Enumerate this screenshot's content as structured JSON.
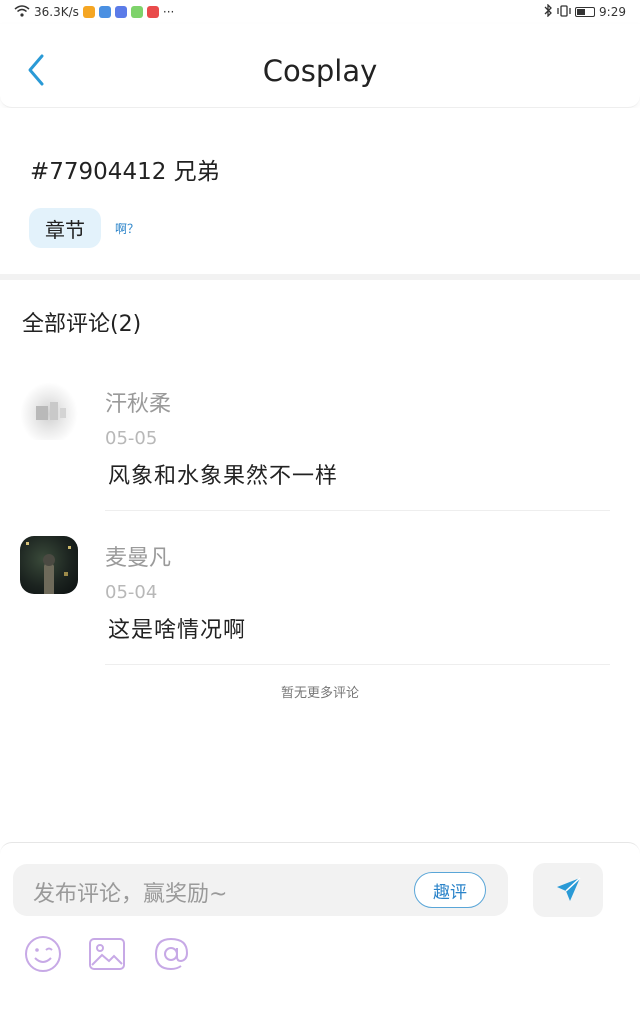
{
  "status_bar": {
    "network_speed": "36.3K/s",
    "more": "···",
    "time": "9:29"
  },
  "header": {
    "title": "Cosplay"
  },
  "post": {
    "title": "#77904412 兄弟",
    "chapter_label": "章节",
    "chapter_sub": "啊？"
  },
  "comments_section": {
    "heading": "全部评论(2)",
    "items": [
      {
        "name": "汗秋柔",
        "date": "05-05",
        "text": "风象和水象果然不一样"
      },
      {
        "name": "麦曼凡",
        "date": "05-04",
        "text": "这是啥情况啊"
      }
    ],
    "no_more": "暂无更多评论"
  },
  "composer": {
    "placeholder": "发布评论，赢奖励~",
    "quzping_label": "趣评"
  },
  "colors": {
    "accent": "#2a83c9",
    "chip_bg": "#e3f2fb",
    "icon_purple": "#c7a9e6"
  }
}
